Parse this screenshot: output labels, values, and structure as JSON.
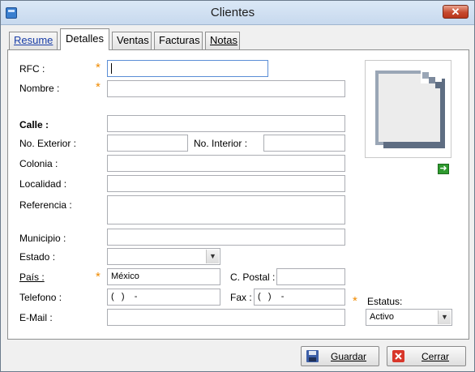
{
  "window": {
    "title": "Clientes",
    "close_glyph": "✕"
  },
  "tabs": [
    {
      "label": "Resume",
      "active": false
    },
    {
      "label": "Detalles",
      "active": true
    },
    {
      "label": "Ventas",
      "active": false
    },
    {
      "label": "Facturas",
      "active": false
    },
    {
      "label": "Notas",
      "active": false
    }
  ],
  "form": {
    "rfc": {
      "label": "RFC :",
      "value": ""
    },
    "nombre": {
      "label": "Nombre :",
      "value": ""
    },
    "calle": {
      "label": "Calle :",
      "value": ""
    },
    "no_exterior": {
      "label": "No. Exterior :",
      "value": ""
    },
    "no_interior": {
      "label": "No. Interior :",
      "value": ""
    },
    "colonia": {
      "label": "Colonia :",
      "value": ""
    },
    "localidad": {
      "label": "Localidad :",
      "value": ""
    },
    "referencia": {
      "label": "Referencia :",
      "value": ""
    },
    "municipio": {
      "label": "Municipio :",
      "value": ""
    },
    "estado": {
      "label": "Estado :",
      "value": ""
    },
    "pais": {
      "label": "País :",
      "value": "México"
    },
    "codigo_postal": {
      "label": "C. Postal :",
      "value": ""
    },
    "telefono": {
      "label": "Telefono :",
      "value": "(   )    -"
    },
    "fax": {
      "label": "Fax :",
      "value": "(   )    -"
    },
    "email": {
      "label": "E-Mail :",
      "value": ""
    },
    "estatus": {
      "label": "Estatus:",
      "value": "Activo"
    },
    "required_marker": "*"
  },
  "buttons": {
    "guardar": "Guardar",
    "cerrar": "Cerrar"
  },
  "icons": {
    "photo_placeholder": "document-placeholder-icon",
    "load_photo": "arrow-right-icon",
    "save": "floppy-disk-icon",
    "close": "red-x-icon"
  },
  "colors": {
    "required": "#f08a00",
    "close_button": "#c74a2f",
    "arrow_icon": "#2f9a2f"
  }
}
